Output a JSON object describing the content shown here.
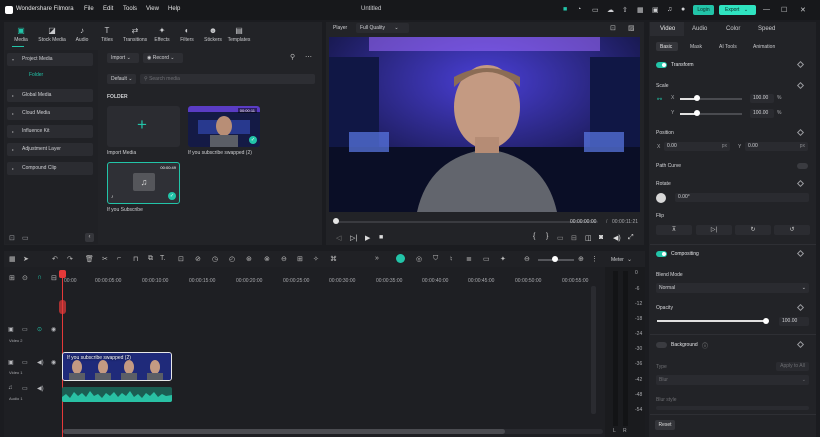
{
  "app": {
    "title": "Wondershare Filmora",
    "menu": [
      "File",
      "Edit",
      "Tools",
      "View",
      "Help"
    ],
    "doc_title": "Untitled",
    "login": "Login",
    "export": "Export"
  },
  "media_tabs": [
    "Media",
    "Stock Media",
    "Audio",
    "Titles",
    "Transitions",
    "Effects",
    "Filters",
    "Stickers",
    "Templates"
  ],
  "sidebar": {
    "project_media": "Project Media",
    "folder": "Folder",
    "items": [
      "Global Media",
      "Cloud Media",
      "Influence Kit",
      "Adjustment Layer",
      "Compound Clip"
    ]
  },
  "library": {
    "import": "Import",
    "record": "Record",
    "search_placeholder": "Search media",
    "sort": "Default",
    "folder_label": "FOLDER",
    "items": [
      {
        "name": "Import Media"
      },
      {
        "name": "If you subscribe swapped (2)",
        "duration": "00:00:11"
      },
      {
        "name": "If you Subscribe",
        "duration": "00:00:49"
      }
    ]
  },
  "player": {
    "label": "Player",
    "quality": "Full Quality",
    "time_current": "00:00:00:00",
    "time_total": "00:00:11:21"
  },
  "props": {
    "tabs": [
      "Video",
      "Audio",
      "Color",
      "Speed"
    ],
    "subtabs": [
      "Basic",
      "Mask",
      "AI Tools",
      "Animation"
    ],
    "transform": "Transform",
    "scale": "Scale",
    "scale_x_label": "X",
    "scale_y_label": "Y",
    "scale_x": "100.00",
    "scale_y": "100.00",
    "unit_pct": "%",
    "position": "Position",
    "pos_x_label": "X",
    "pos_x": "0.00",
    "pos_y_label": "Y",
    "pos_y": "0.00",
    "unit_px": "px",
    "path_curve": "Path Curve",
    "rotate": "Rotate",
    "rotate_val": "0.00°",
    "flip": "Flip",
    "compositing": "Compositing",
    "blend_mode": "Blend Mode",
    "blend_val": "Normal",
    "opacity": "Opacity",
    "opacity_val": "100.00",
    "background": "Background",
    "type": "Type",
    "apply_all": "Apply to All",
    "type_val": "Blur",
    "blur_style": "Blur style",
    "reset": "Reset"
  },
  "timeline": {
    "meter": "Meter",
    "ticks": [
      "00:00",
      "00:00:05:00",
      "00:00:10:00",
      "00:00:15:00",
      "00:00:20:00",
      "00:00:25:00",
      "00:00:30:00",
      "00:00:35:00",
      "00:00:40:00",
      "00:00:45:00",
      "00:00:50:00",
      "00:00:55:00"
    ],
    "tracks": [
      {
        "label": "Video 2"
      },
      {
        "label": "Video 1"
      },
      {
        "label": "Audio 1"
      }
    ],
    "clip_title": "If you subscribe swapped (2)",
    "meter_scale": [
      "0",
      "-6",
      "-12",
      "-18",
      "-24",
      "-30",
      "-36",
      "-42",
      "-48",
      "-54"
    ],
    "lr": [
      "L",
      "R"
    ]
  },
  "colors": {
    "accent": "#22c4a8",
    "export": "#2fe3c0",
    "bg": "#1b1c20"
  }
}
